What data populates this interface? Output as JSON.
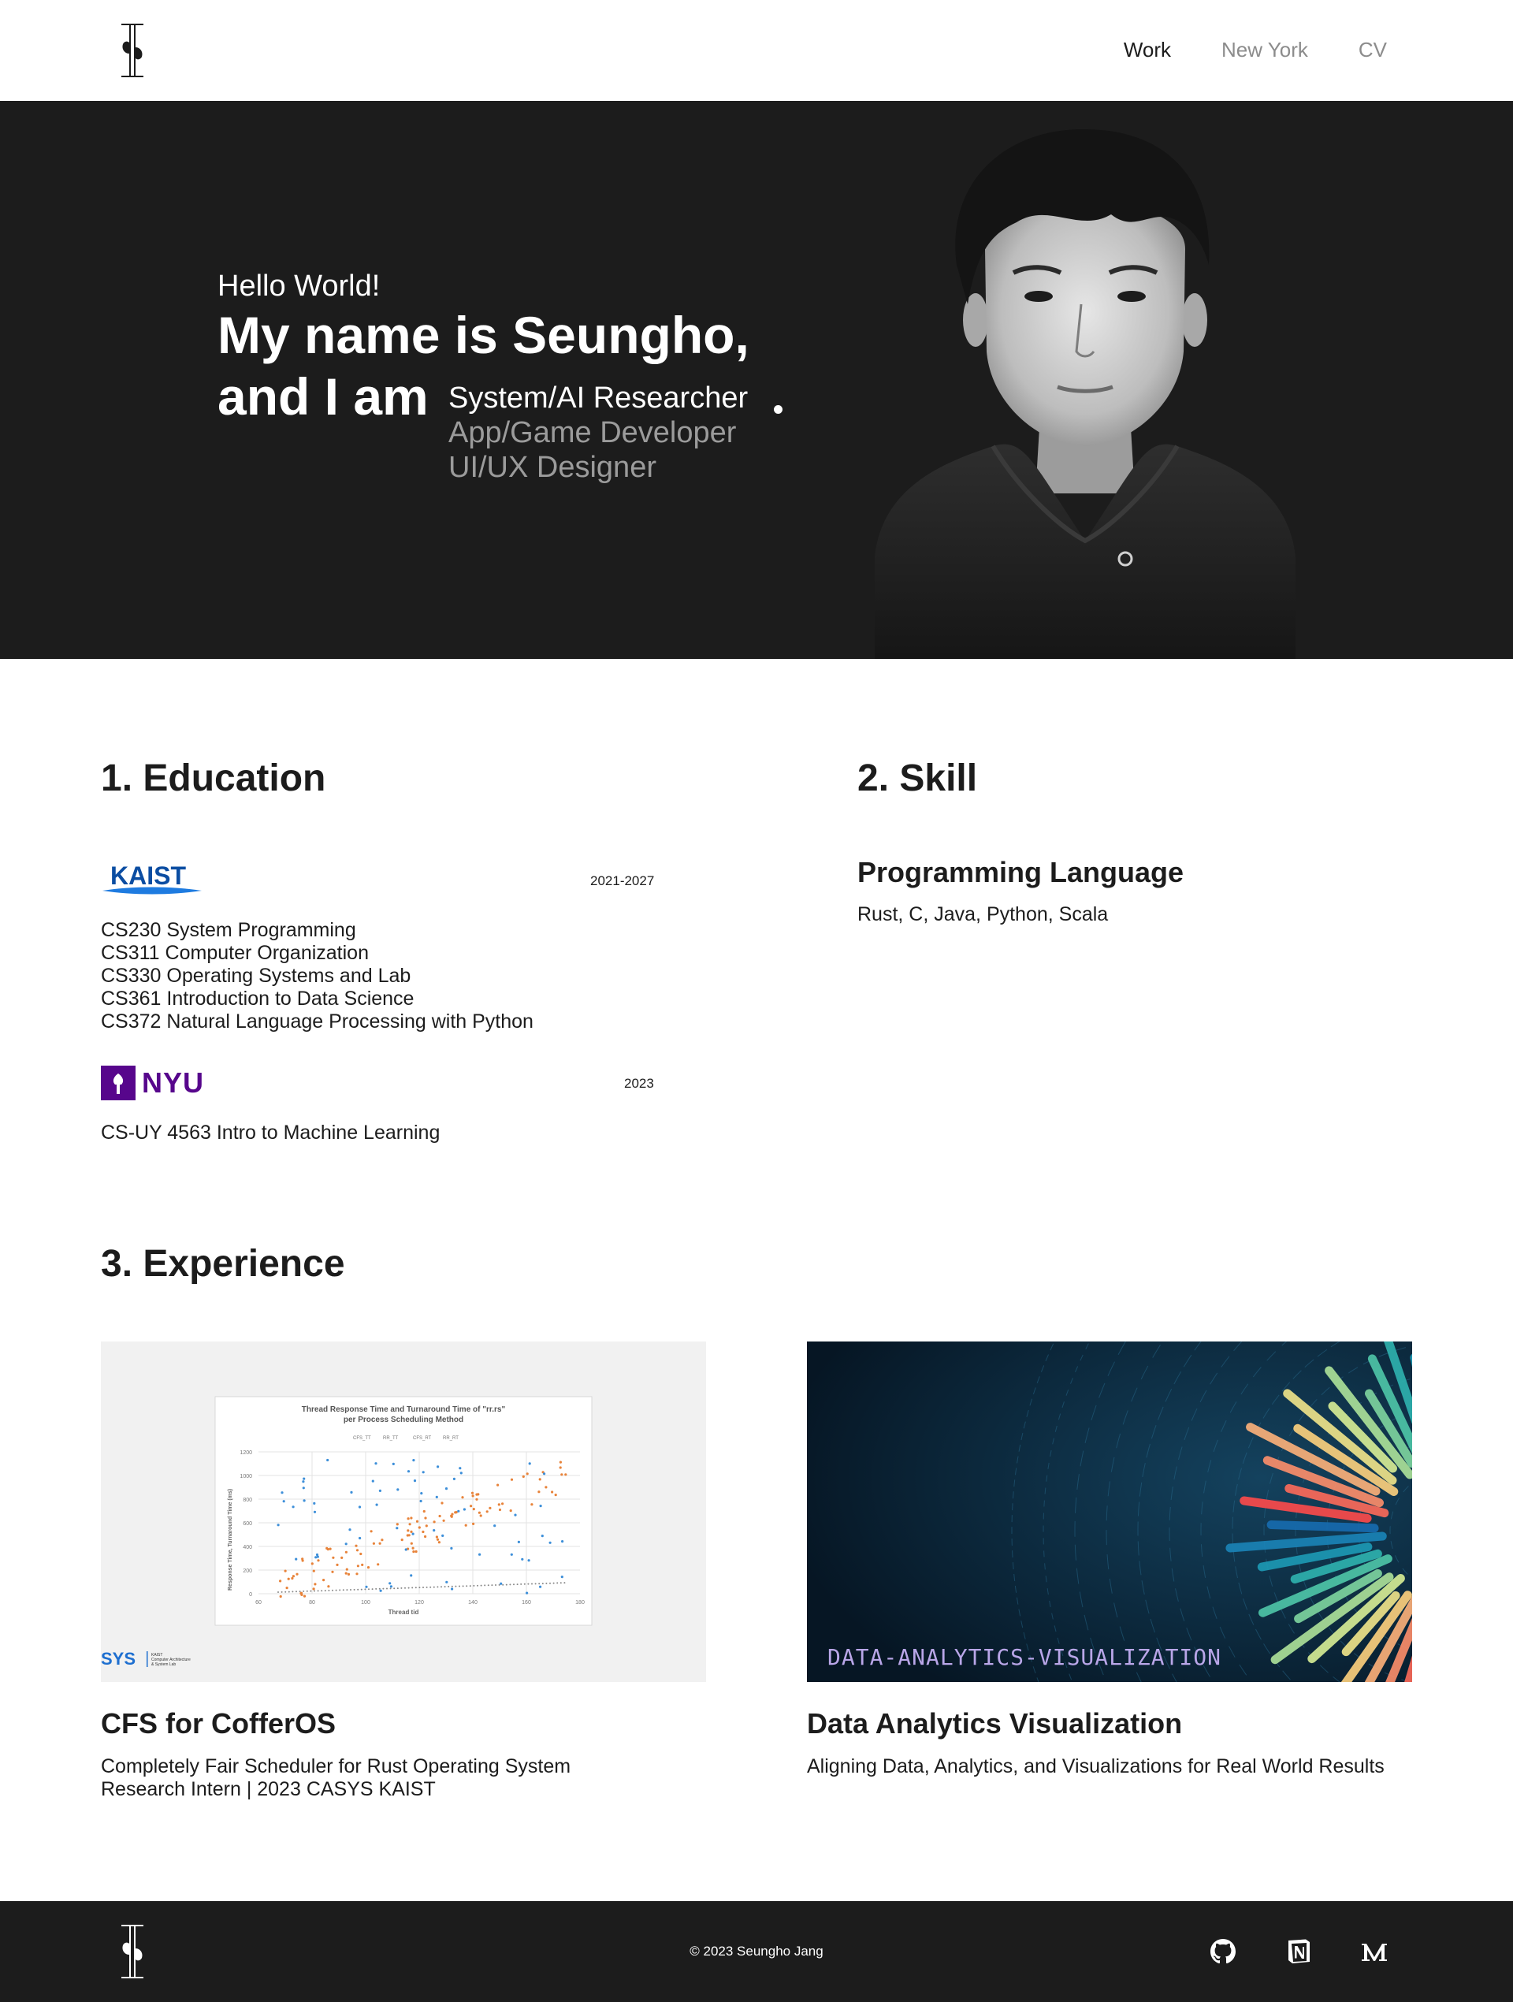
{
  "nav": {
    "items": [
      "Work",
      "New York",
      "CV"
    ]
  },
  "hero": {
    "greeting": "Hello World!",
    "name_line1": "My name is Seungho,",
    "name_line2": "and I am",
    "roles": [
      "System/AI Researcher",
      "App/Game Developer",
      "UI/UX Designer"
    ]
  },
  "education": {
    "title": "1. Education",
    "schools": [
      {
        "logo_text": "KAIST",
        "years": "2021-2027",
        "courses": [
          "CS230 System Programming",
          "CS311 Computer Organization",
          "CS330 Operating Systems and Lab",
          "CS361 Introduction to Data Science",
          "CS372 Natural Language Processing with Python"
        ]
      },
      {
        "logo_text": "NYU",
        "years": "2023",
        "courses": [
          "CS-UY 4563 Intro to Machine Learning"
        ]
      }
    ]
  },
  "skill": {
    "title": "2. Skill",
    "heading": "Programming Language",
    "value": "Rust, C, Java, Python, Scala"
  },
  "experience": {
    "title": "3. Experience",
    "cards": [
      {
        "title": "CFS for CofferOS",
        "desc_lines": [
          "Completely Fair Scheduler for Rust Operating System",
          "Research Intern | 2023 CASYS KAIST"
        ],
        "thumb": {
          "chart_title_1": "Thread Response Time and Turnaround Time of \"rr.rs\"",
          "chart_title_2": "per Process Scheduling Method",
          "legend": [
            "CFS_TT",
            "RR_TT",
            "CFS_RT",
            "RR_RT"
          ],
          "ylabel": "Response Time, Turnaround Time (ms)",
          "xlabel": "Thread tid",
          "yticks": [
            "0",
            "200",
            "400",
            "600",
            "800",
            "1000",
            "1200"
          ],
          "xticks": [
            "60",
            "80",
            "100",
            "120",
            "140",
            "160",
            "180"
          ],
          "lab_logo": "SYS",
          "lab_line1": "KAIST",
          "lab_line2": "Computer Architecture",
          "lab_line3": "& System Lab"
        }
      },
      {
        "title": "Data Analytics Visualization",
        "desc_lines": [
          "Aligning Data, Analytics, and Visualizations for Real World Results"
        ],
        "thumb": {
          "caption": "DATA-ANALYTICS-VISUALIZATION"
        }
      }
    ]
  },
  "footer": {
    "copyright": "© 2023 Seungho Jang"
  },
  "colors": {
    "dark": "#1c1c1c",
    "kaist_blue": "#0b4da2",
    "nyu_purple": "#57068c",
    "muted": "#8c8c8c"
  },
  "icons": [
    "github-icon",
    "notion-icon",
    "medium-icon"
  ]
}
